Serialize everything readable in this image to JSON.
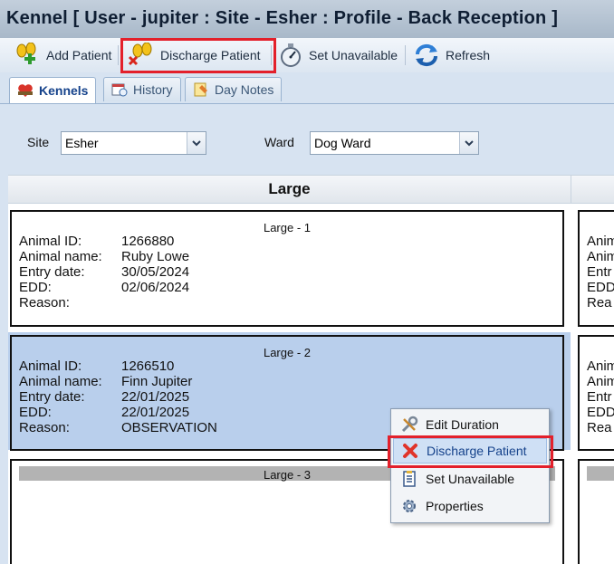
{
  "window": {
    "title": "Kennel [ User - jupiter : Site - Esher : Profile - Back Reception ]"
  },
  "toolbar": {
    "add_patient": "Add Patient",
    "discharge_patient": "Discharge Patient",
    "set_unavailable": "Set Unavailable",
    "refresh": "Refresh"
  },
  "tabs": [
    {
      "label": "Kennels",
      "active": true
    },
    {
      "label": "History",
      "active": false
    },
    {
      "label": "Day Notes",
      "active": false
    }
  ],
  "filters": {
    "site_label": "Site",
    "site_value": "Esher",
    "ward_label": "Ward",
    "ward_value": "Dog Ward"
  },
  "grid": {
    "column_header": "Large"
  },
  "kennels": [
    {
      "title": "Large - 1",
      "fields": [
        {
          "label": "Animal ID:",
          "value": "1266880"
        },
        {
          "label": "Animal name:",
          "value": "Ruby Lowe"
        },
        {
          "label": "Entry date:",
          "value": "30/05/2024"
        },
        {
          "label": "EDD:",
          "value": "02/06/2024"
        },
        {
          "label": "Reason:",
          "value": ""
        }
      ]
    },
    {
      "title": "Large - 2",
      "fields": [
        {
          "label": "Animal ID:",
          "value": "1266510"
        },
        {
          "label": "Animal name:",
          "value": "Finn Jupiter"
        },
        {
          "label": "Entry date:",
          "value": "22/01/2025"
        },
        {
          "label": "EDD:",
          "value": "22/01/2025"
        },
        {
          "label": "Reason:",
          "value": "OBSERVATION"
        }
      ]
    },
    {
      "title": "Large - 3",
      "fields": []
    }
  ],
  "right_column_labels": [
    "Anim",
    "Anim",
    "Entr",
    "EDD",
    "Rea"
  ],
  "context_menu": {
    "items": [
      "Edit Duration",
      "Discharge Patient",
      "Set Unavailable",
      "Properties"
    ]
  },
  "colors": {
    "highlight": "#e3202b",
    "selection": "#b9cfec",
    "title_text": "#0f1e33"
  }
}
